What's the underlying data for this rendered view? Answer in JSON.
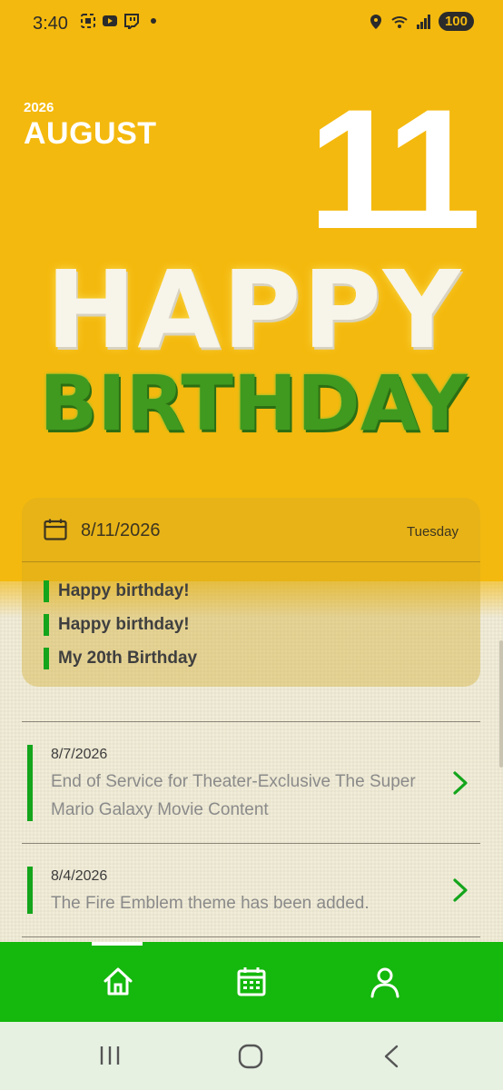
{
  "status_bar": {
    "time": "3:40",
    "battery": "100"
  },
  "header": {
    "year": "2026",
    "month": "AUGUST",
    "day": "11"
  },
  "art": {
    "line1": "HAPPY",
    "line2": "BIRTHDAY"
  },
  "day_card": {
    "date": "8/11/2026",
    "weekday": "Tuesday",
    "events": [
      "Happy birthday!",
      "Happy birthday!",
      "My 20th Birthday"
    ]
  },
  "news": [
    {
      "date": "8/7/2026",
      "title": "End of Service for Theater-Exclusive The Super Mario Galaxy Movie Content"
    },
    {
      "date": "8/4/2026",
      "title": "The Fire Emblem theme has been added."
    }
  ],
  "bottom_nav": {
    "items": [
      "home-icon",
      "calendar-icon",
      "profile-icon"
    ],
    "active": 0
  },
  "colors": {
    "accent": "#15b80d",
    "hero": "#f4b90e"
  }
}
